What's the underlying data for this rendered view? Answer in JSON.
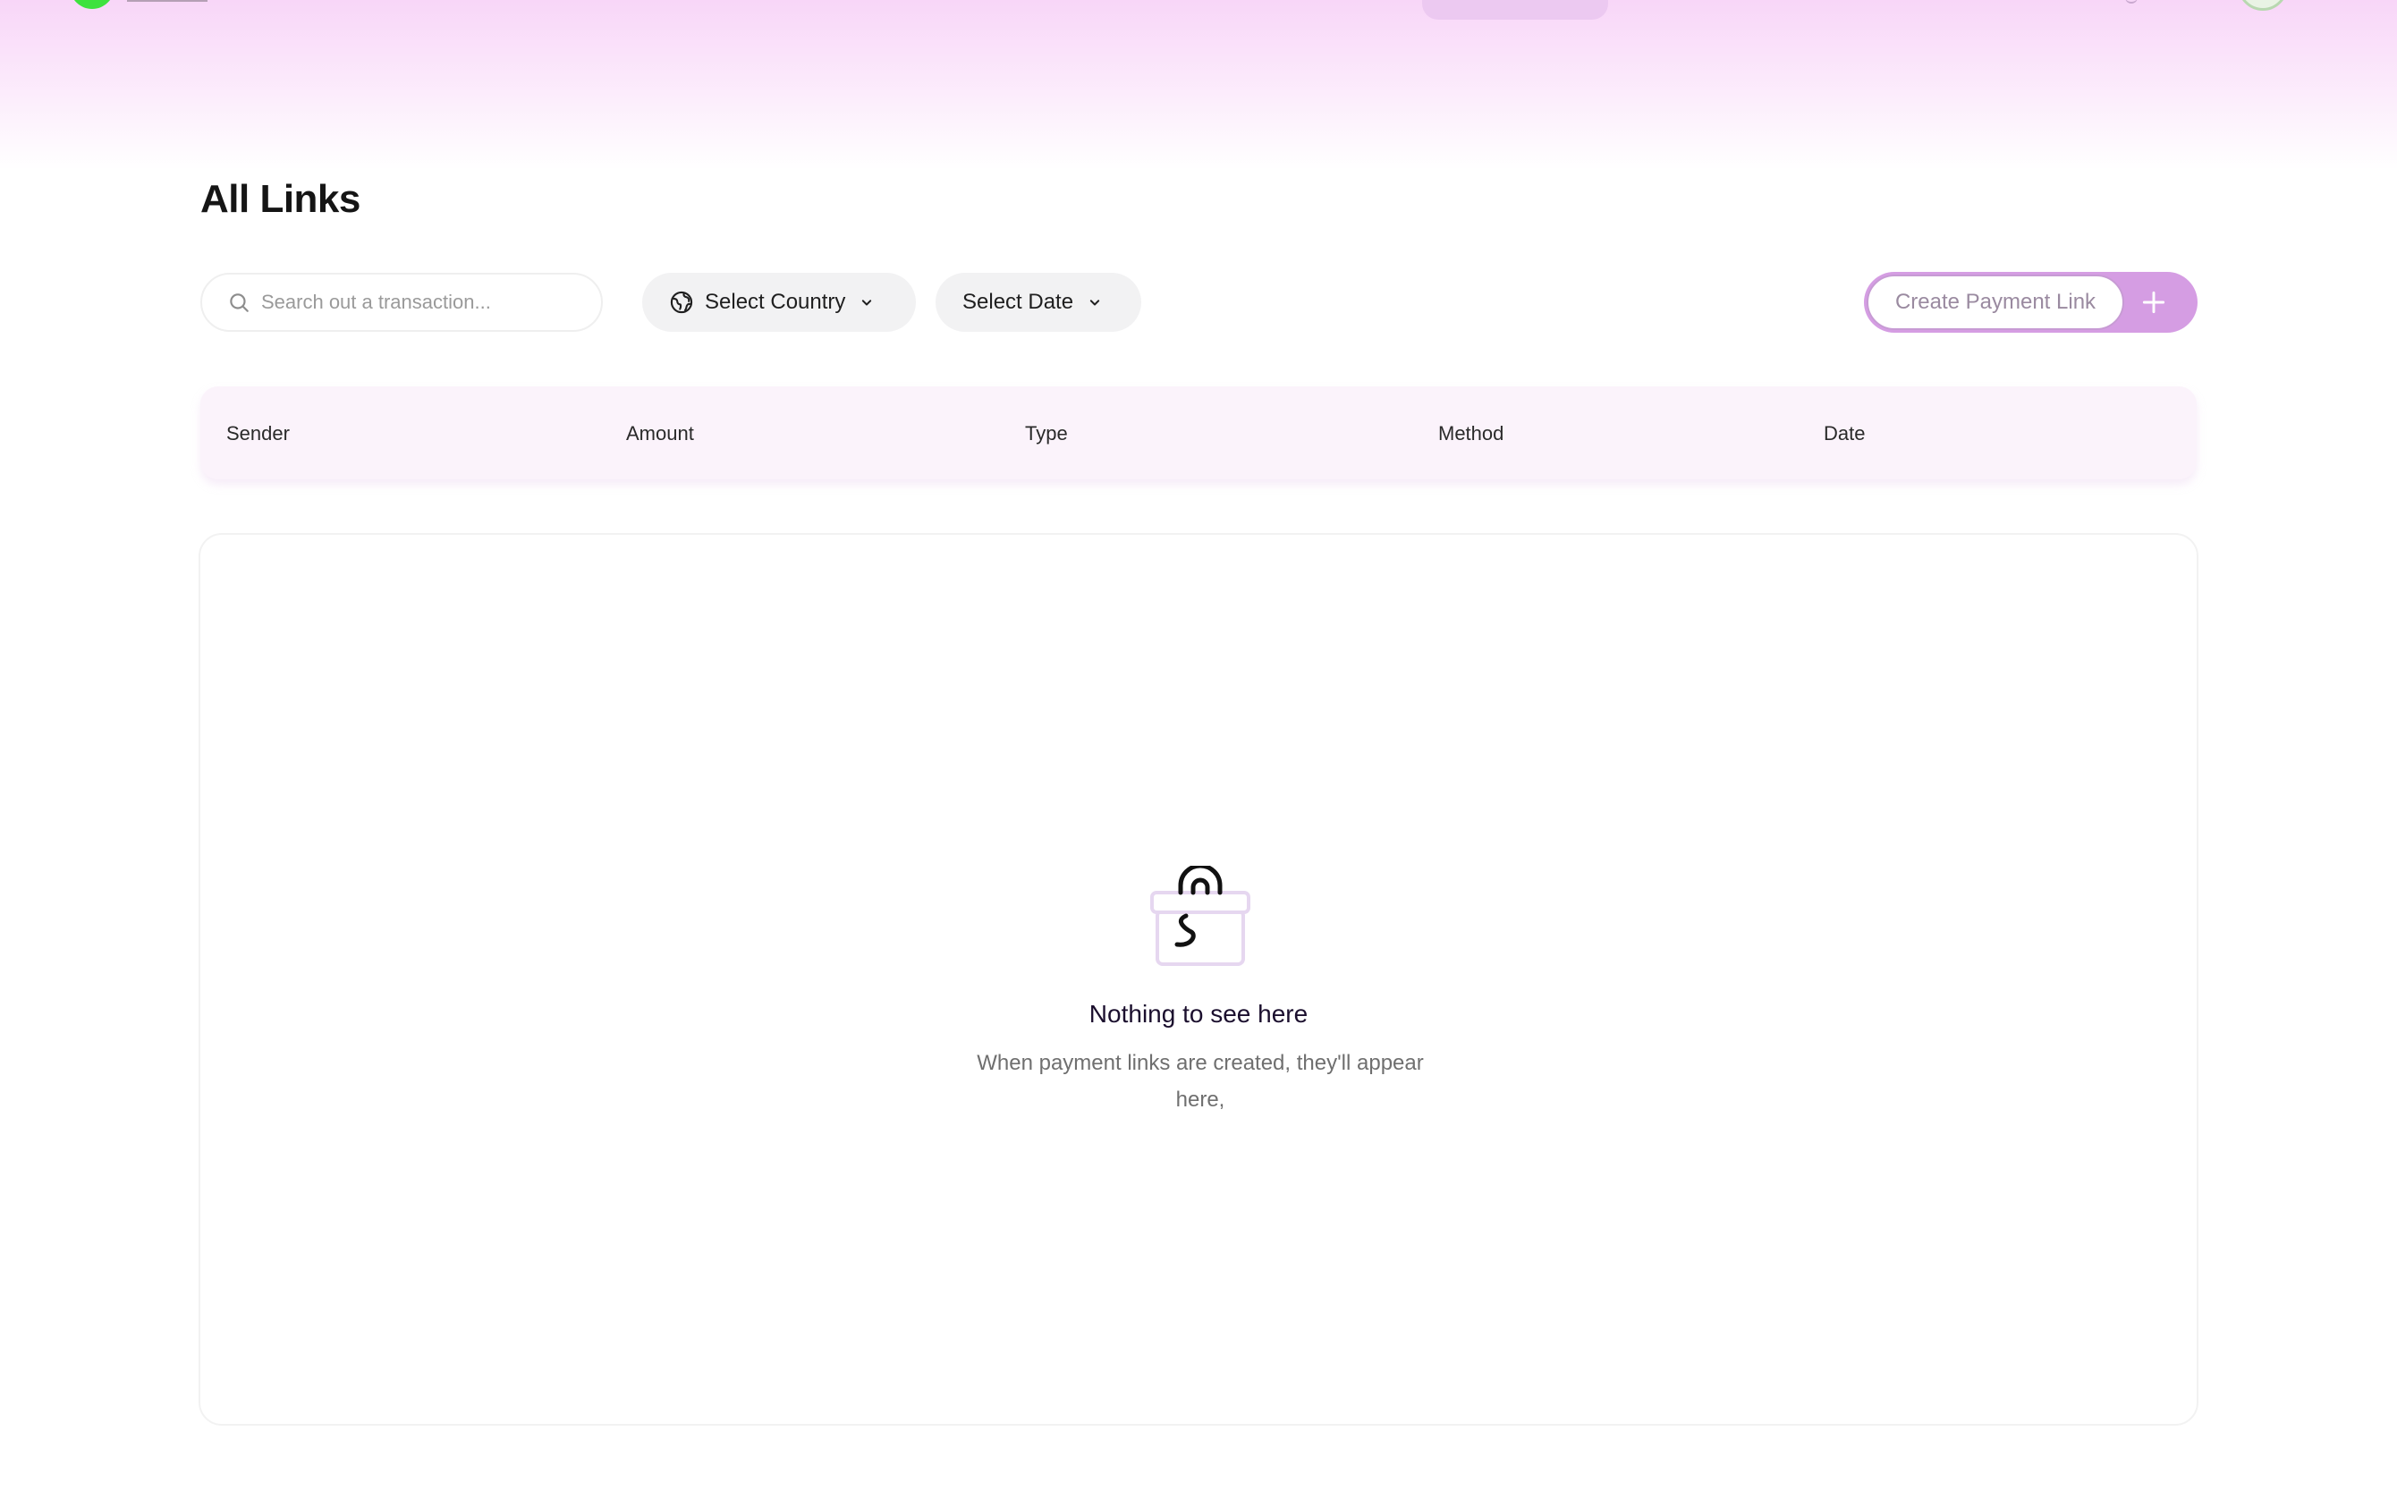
{
  "page": {
    "title": "All Links"
  },
  "filters": {
    "search_placeholder": "Search out a transaction...",
    "country_label": "Select Country",
    "date_label": "Select Date"
  },
  "actions": {
    "create_link_label": "Create Payment Link"
  },
  "table": {
    "columns": [
      "Sender",
      "Amount",
      "Type",
      "Method",
      "Date"
    ]
  },
  "empty_state": {
    "title": "Nothing to see here",
    "description": "When payment links are created, they'll appear here,"
  },
  "icons": {
    "search": "search-icon",
    "country": "globe-icon",
    "dropdown": "chevron-down-icon",
    "create": "plus-icon",
    "empty": "payment-link-box-icon"
  },
  "colors": {
    "accent": "#d59de3",
    "header_bg": "#fbf3fb",
    "top_gradient": "#f8d6f8",
    "logo_green": "#3ee23e"
  }
}
